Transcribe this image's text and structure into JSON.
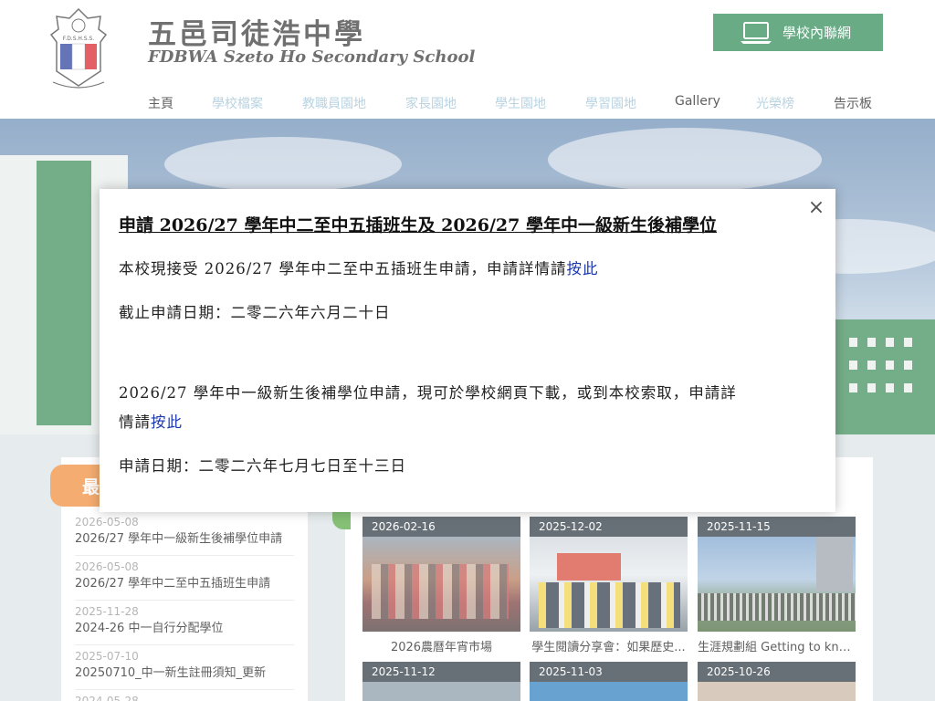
{
  "header": {
    "school_name_zh": "五邑司徒浩中學",
    "school_name_en": "FDBWA Szeto Ho Secondary School",
    "crest_text": "F.D.S.H.S.S.",
    "intranet_label": "學校內聯網"
  },
  "nav": {
    "items": [
      {
        "label": "主頁"
      },
      {
        "label": "學校檔案"
      },
      {
        "label": "教職員園地"
      },
      {
        "label": "家長園地"
      },
      {
        "label": "學生園地"
      },
      {
        "label": "學習園地"
      },
      {
        "label": "Gallery"
      },
      {
        "label": "光榮榜"
      },
      {
        "label": "告示板"
      }
    ]
  },
  "news": {
    "ribbon_text": "最",
    "items": [
      {
        "date": "2026-05-08",
        "title": "2026/27 學年中一級新生後補學位申請"
      },
      {
        "date": "2026-05-08",
        "title": "2026/27 學年中二至中五插班生申請"
      },
      {
        "date": "2025-11-28",
        "title": "2024-26 中一自行分配學位"
      },
      {
        "date": "2025-07-10",
        "title": "20250710_中一新生註冊須知_更新"
      },
      {
        "date": "2024-05-28",
        "title": ""
      }
    ]
  },
  "gallery": {
    "cards": [
      {
        "date": "2026-02-16",
        "caption": "2026農曆年宵市場"
      },
      {
        "date": "2025-12-02",
        "caption": "學生閱讀分享會：如果歷史..."
      },
      {
        "date": "2025-11-15",
        "caption": "生涯規劃組 Getting to kno..."
      },
      {
        "date": "2025-11-12",
        "caption": ""
      },
      {
        "date": "2025-11-03",
        "caption": ""
      },
      {
        "date": "2025-10-26",
        "caption": ""
      }
    ]
  },
  "modal": {
    "close": "×",
    "title": "申請 2026/27 學年中二至中五插班生及 2026/27 學年中一級新生後補學位",
    "p1_text": "本校現接受 2026/27 學年中二至中五插班生申請，申請詳情請",
    "p1_link": "按此",
    "p2": "截止申請日期：二零二六年六月二十日",
    "p3_line1": "2026/27 學年中一級新生後補學位申請，現可於學校網頁下載，或到本校索取，申請詳",
    "p3_line2_text": "情請",
    "p3_link": "按此",
    "p4": "申請日期：二零二六年七月七日至十三日"
  },
  "colors": {
    "intranet_green": "#2e8b57",
    "nav_inactive": "#9ec3d6",
    "link_blue": "#1a37b0",
    "news_ribbon": "#f08c3a"
  }
}
